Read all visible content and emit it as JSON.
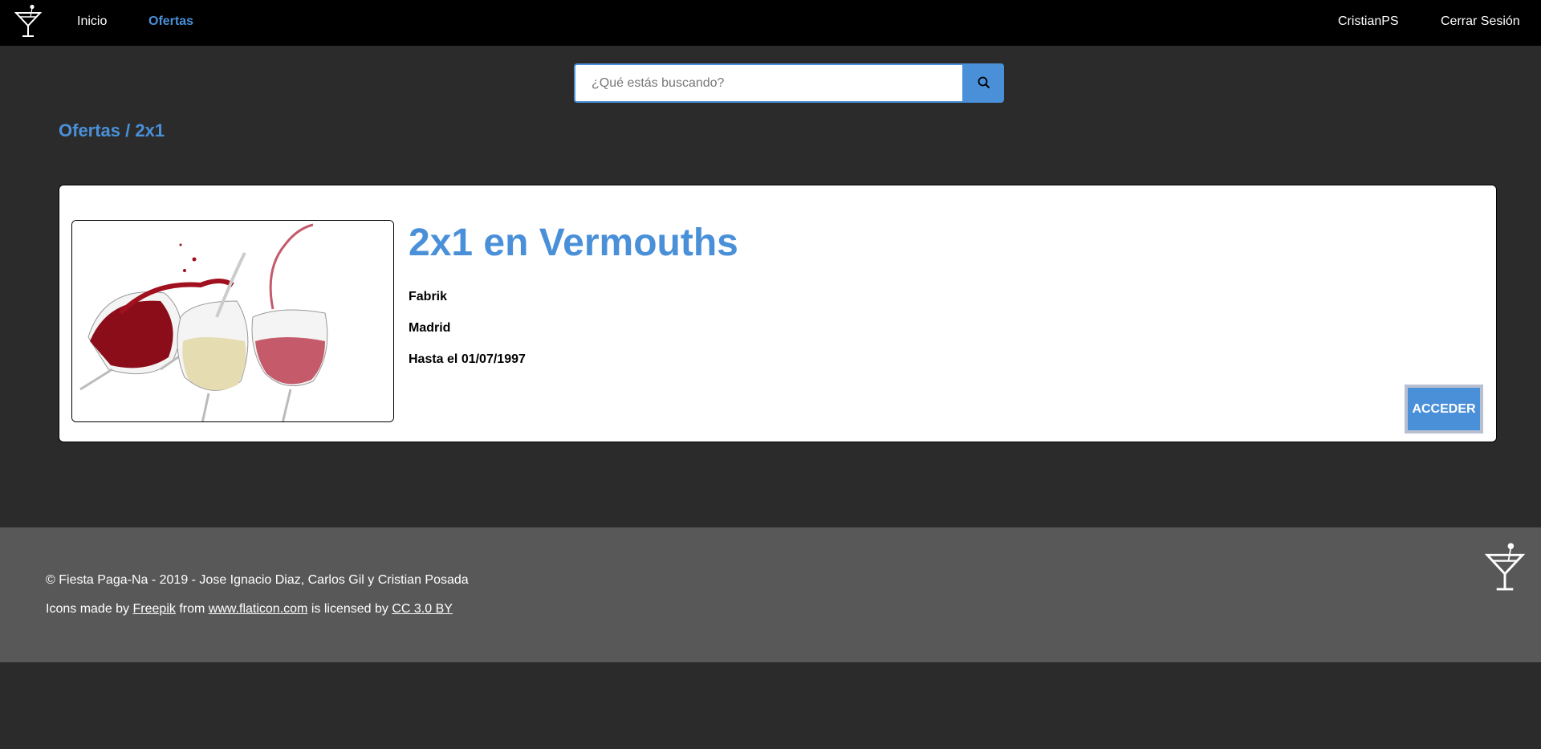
{
  "nav": {
    "logo": "cocktail-glass-icon",
    "links": [
      {
        "label": "Inicio",
        "active": false
      },
      {
        "label": "Ofertas",
        "active": true
      }
    ],
    "user": "CristianPS",
    "logout": "Cerrar Sesión"
  },
  "search": {
    "placeholder": "¿Qué estás buscando?",
    "value": "",
    "icon": "search-icon"
  },
  "breadcrumb": "Ofertas / 2x1",
  "offer": {
    "image": "wine-glasses-splash",
    "title": "2x1 en Vermouths",
    "venue": "Fabrik",
    "city": "Madrid",
    "valid_until": "Hasta el 01/07/1997",
    "action": "ACCEDER"
  },
  "footer": {
    "copyright": "© Fiesta Paga-Na - 2019 - Jose Ignacio Diaz, Carlos Gil y Cristian Posada",
    "credits_prefix": "Icons made by",
    "credits_author": "Freepik",
    "credits_from": "from",
    "credits_site": "www.flaticon.com",
    "credits_license_text": "is licensed by",
    "credits_license": "CC 3.0 BY",
    "logo": "cocktail-glass-icon"
  },
  "colors": {
    "accent": "#4a90d9",
    "background": "#2b2b2b",
    "topbar": "#000000",
    "footer": "#585858"
  }
}
